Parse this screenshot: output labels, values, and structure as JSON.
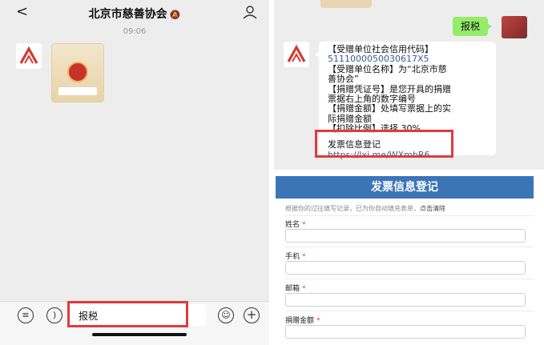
{
  "chat": {
    "back_icon": "chevron-left-icon",
    "title": "北京市慈善协会",
    "mute_icon": "mute-icon",
    "time": "09:06",
    "input_value": "报税"
  },
  "reply": {
    "sent_text": "报税",
    "lines": [
      "【受赠单位社会信用代码】",
      "5111000050030617X5",
      "【受赠单位名称】为“北京市慈",
      "善协会”",
      "【捐赠凭证号】是您开具的捐赠",
      "票据右上角的数字编号",
      "【捐赠金额】处填写票据上的实",
      "际捐赠金额",
      "【扣除比例】选择 30%"
    ],
    "link_title": "发票信息登记",
    "link_url": "https://lxi.me/WXmbR6"
  },
  "form": {
    "header": "发票信息登记",
    "notice": "根据你的过往填写记录，已为你自动填充表单，",
    "clear": "点击清除",
    "required_mark": "*",
    "fields": [
      {
        "label": "姓名"
      },
      {
        "label": "手机"
      },
      {
        "label": "邮箱"
      },
      {
        "label": "捐赠金额"
      }
    ]
  },
  "colors": {
    "sent_bubble": "#95ec69",
    "form_header": "#3c74b8",
    "highlight": "#e03b3b"
  }
}
